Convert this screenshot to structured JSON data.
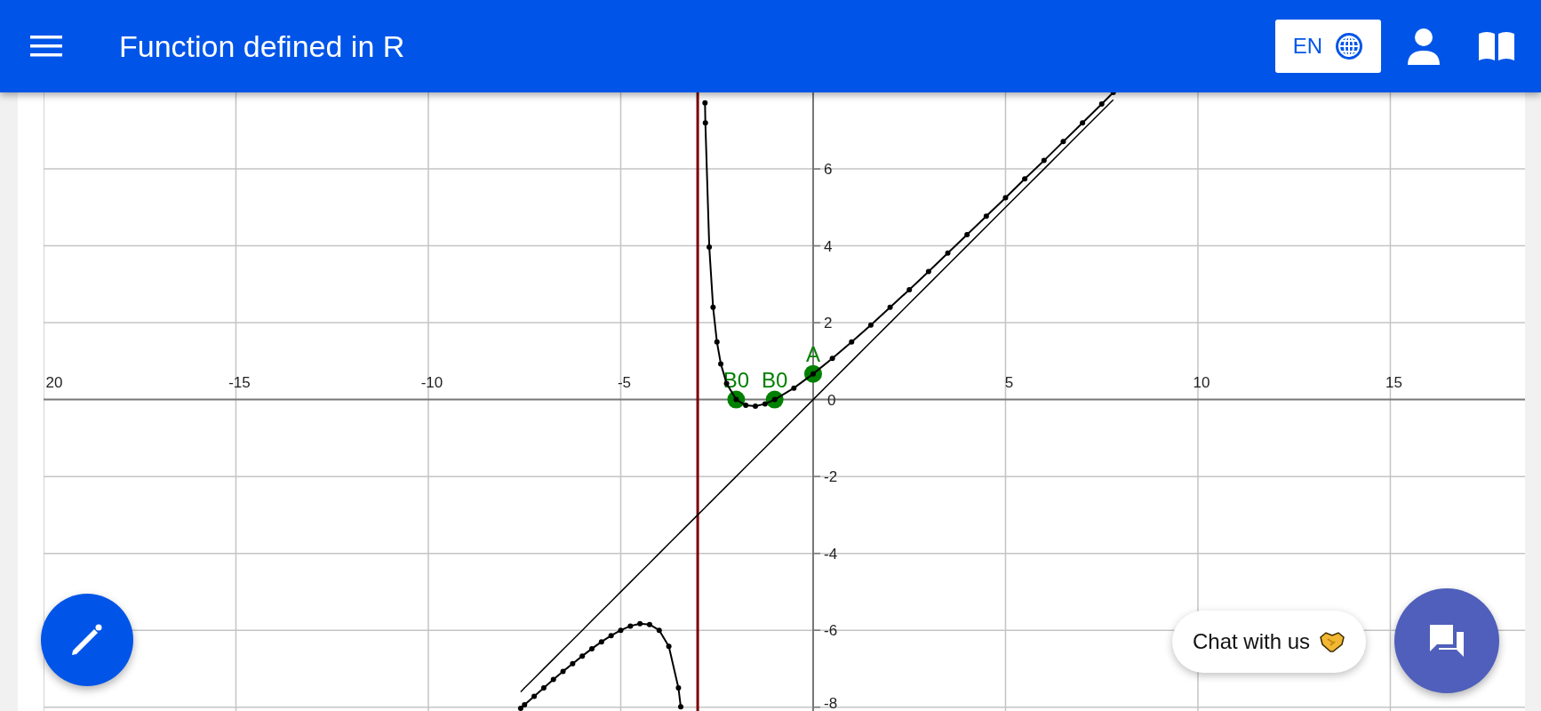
{
  "app_bar": {
    "title": "Function defined in R",
    "language": "EN"
  },
  "graph": {
    "chart_data": {
      "type": "line",
      "xlim": [
        -20,
        18.5
      ],
      "ylim": [
        -8.1,
        7.99
      ],
      "grid": true,
      "xticks": [
        {
          "value": -20,
          "label": "20"
        },
        -15,
        -10,
        -5,
        5,
        10,
        15
      ],
      "yticks": [
        -8,
        -6,
        -4,
        -2,
        0,
        2,
        4,
        6
      ],
      "x": [
        -7.6,
        -7.5,
        -7.25,
        -7,
        -6.75,
        -6.5,
        -6.25,
        -6,
        -5.75,
        -5.5,
        -5.25,
        -5,
        -4.75,
        -4.5,
        -4.25,
        -4,
        -3.75,
        -3.5,
        -3.44,
        -3,
        -2.81,
        -2.8,
        -2.7,
        -2.6,
        -2.5,
        -2.4,
        -2.25,
        -2,
        -1.75,
        -1.5,
        -1.25,
        -1,
        -0.5,
        0,
        0.5,
        1,
        1.5,
        2,
        2.5,
        3,
        3.5,
        4,
        4.5,
        5,
        5.5,
        6,
        6.5,
        7,
        7.5,
        7.8
      ],
      "series": [
        {
          "color": "#000000",
          "marker": true,
          "values": [
            -8.03,
            -7.94,
            -7.72,
            -7.5,
            -7.28,
            -7.07,
            -6.87,
            -6.67,
            -6.48,
            -6.3,
            -6.14,
            -6,
            -5.89,
            -5.83,
            -5.85,
            -6,
            -6.42,
            -7.5,
            -7.99,
            null,
            7.72,
            7.2,
            3.97,
            2.4,
            1.5,
            0.93,
            0.42,
            0,
            -0.15,
            -0.17,
            -0.11,
            0,
            0.3,
            0.67,
            1.07,
            1.5,
            1.94,
            2.4,
            2.86,
            3.33,
            3.81,
            4.29,
            4.77,
            5.25,
            5.74,
            6.22,
            6.71,
            7.2,
            7.69,
            7.99
          ]
        },
        {
          "color": "#000000",
          "marker": false,
          "values": [
            -7.6,
            -7.5,
            -7.25,
            -7,
            -6.75,
            -6.5,
            -6.25,
            -6,
            -5.75,
            -5.5,
            -5.25,
            -5,
            -4.75,
            -4.5,
            -4.25,
            -4,
            -3.75,
            -3.5,
            -3.44,
            -3,
            -2.81,
            -2.8,
            -2.7,
            -2.6,
            -2.5,
            -2.4,
            -2.25,
            -2,
            -1.75,
            -1.5,
            -1.25,
            -1,
            -0.5,
            0,
            0.5,
            1,
            1.5,
            2,
            2.5,
            3,
            3.5,
            4,
            4.5,
            5,
            5.5,
            6,
            6.5,
            7,
            7.5,
            7.8
          ]
        }
      ],
      "ref_lines": [
        {
          "axis": "x",
          "value": -3
        }
      ],
      "annotations": [
        {
          "x": -2,
          "y": 0,
          "text": "B0"
        },
        {
          "x": -1,
          "y": 0,
          "text": "B0"
        },
        {
          "x": 0,
          "y": 0.67,
          "text": "A"
        }
      ]
    }
  },
  "chat": {
    "label": "Chat with us"
  }
}
